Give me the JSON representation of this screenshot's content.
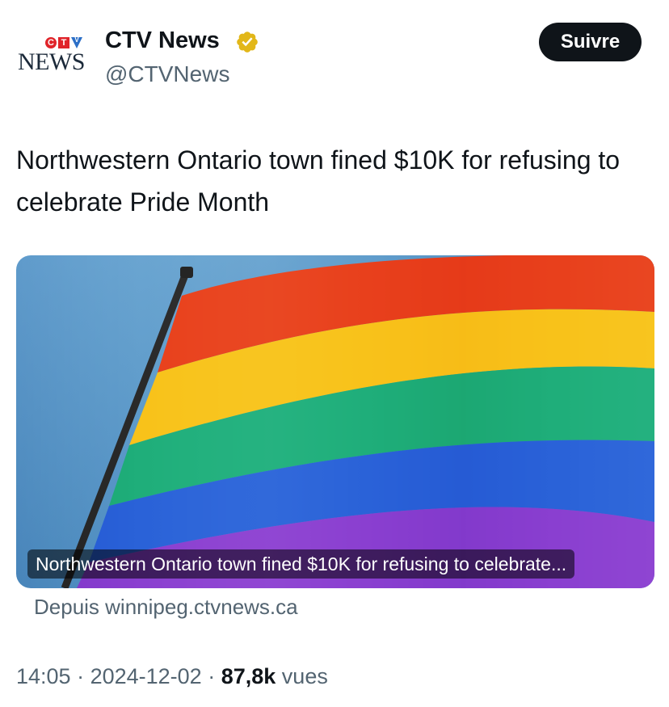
{
  "account": {
    "avatar_top": "CTV",
    "avatar_bottom": "NEWS",
    "name": "CTV News",
    "handle": "@CTVNews",
    "verified_icon": "verified-gold-badge-icon",
    "follow_label": "Suivre"
  },
  "tweet": {
    "text": "Northwestern Ontario town fined $10K for refusing to celebrate Pride Month"
  },
  "card": {
    "image_desc_icon": "rainbow-flag-image",
    "caption": "Northwestern Ontario town fined $10K for refusing to celebrate...",
    "source": "Depuis winnipeg.ctvnews.ca"
  },
  "meta": {
    "time": "14:05",
    "date": "2024-12-02",
    "views_count": "87,8k",
    "views_label": "vues",
    "separator": " · "
  },
  "colors": {
    "text": "#0f1419",
    "secondary": "#536471",
    "badge_gold": "#e2b719",
    "ctv_red": "#e0242a",
    "ctv_blue": "#2c6fc7"
  }
}
